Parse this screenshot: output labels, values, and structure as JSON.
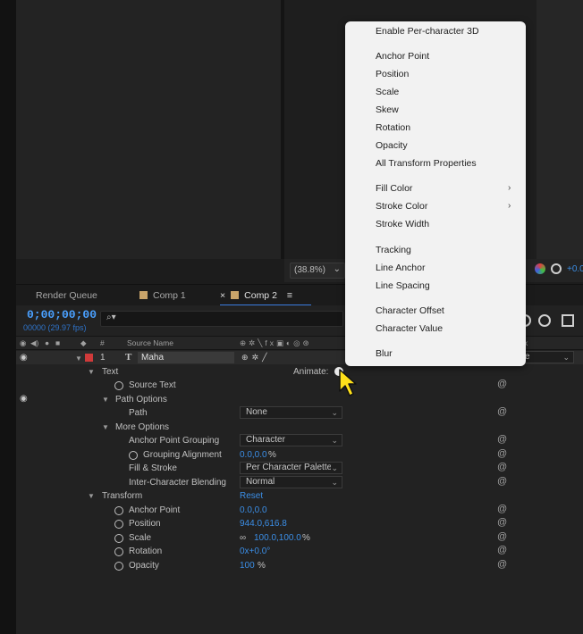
{
  "viewer": {
    "zoom": "(38.8%)",
    "zoom_chevron": "⌄",
    "readout": "+0.0"
  },
  "tabs": [
    {
      "label": "Render Queue"
    },
    {
      "label": "Comp 1"
    },
    {
      "label": "Comp 2",
      "close": "×",
      "menu": "≡"
    }
  ],
  "timeline": {
    "timecode": "0;00;00;00",
    "fps": "00000 (29.97 fps)",
    "search_icon": "⌕▾",
    "columns": {
      "num": "#",
      "source_name": "Source Name",
      "mode_partial": "k"
    },
    "layer": {
      "number": "1",
      "type_icon": "T",
      "name": "Maha",
      "mode_partial": "e"
    },
    "animate_label": "Animate:",
    "reset_label": "Reset"
  },
  "properties": [
    {
      "name": "Text",
      "indent": 1,
      "twirl": true
    },
    {
      "name": "Source Text",
      "indent": 2,
      "stopwatch": true,
      "spiral": true
    },
    {
      "name": "Path Options",
      "indent": 2,
      "twirl": true
    },
    {
      "name": "Path",
      "indent": 3,
      "dropdown": "None",
      "spiral": true
    },
    {
      "name": "More Options",
      "indent": 2,
      "twirl": true
    },
    {
      "name": "Anchor Point Grouping",
      "indent": 3,
      "dropdown": "Character",
      "spiral": true
    },
    {
      "name": "Grouping Alignment",
      "indent": 3,
      "stopwatch": true,
      "value": "0.0,0.0",
      "unit": "%",
      "spiral": true
    },
    {
      "name": "Fill & Stroke",
      "indent": 3,
      "dropdown": "Per Character Palette",
      "spiral": true
    },
    {
      "name": "Inter-Character Blending",
      "indent": 3,
      "dropdown": "Normal",
      "spiral": true
    },
    {
      "name": "Transform",
      "indent": 1,
      "twirl": true
    },
    {
      "name": "Anchor Point",
      "indent": 2,
      "stopwatch": true,
      "value": "0.0,0.0",
      "spiral": true
    },
    {
      "name": "Position",
      "indent": 2,
      "stopwatch": true,
      "value": "944.0,616.8",
      "spiral": true
    },
    {
      "name": "Scale",
      "indent": 2,
      "stopwatch": true,
      "value": "100.0,100.0",
      "unit": "%",
      "spiral": true
    },
    {
      "name": "Rotation",
      "indent": 2,
      "stopwatch": true,
      "value": "0x+0.0°",
      "spiral": true
    },
    {
      "name": "Opacity",
      "indent": 2,
      "stopwatch": true,
      "value": "100",
      "unit": "%",
      "spiral": true
    }
  ],
  "menu": {
    "items": [
      {
        "label": "Enable Per-character 3D"
      },
      {
        "label": "Anchor Point"
      },
      {
        "label": "Position"
      },
      {
        "label": "Scale"
      },
      {
        "label": "Skew"
      },
      {
        "label": "Rotation"
      },
      {
        "label": "Opacity"
      },
      {
        "label": "All Transform Properties"
      },
      {
        "label": "Fill Color",
        "submenu": true
      },
      {
        "label": "Stroke Color",
        "submenu": true
      },
      {
        "label": "Stroke Width"
      },
      {
        "label": "Tracking"
      },
      {
        "label": "Line Anchor"
      },
      {
        "label": "Line Spacing"
      },
      {
        "label": "Character Offset"
      },
      {
        "label": "Character Value"
      },
      {
        "label": "Blur"
      }
    ],
    "submenu_arrow": "›"
  },
  "colors": {
    "accent_blue": "#3b8ee6",
    "label_red": "#d03a3a",
    "menu_bg": "#f2f2f2"
  }
}
